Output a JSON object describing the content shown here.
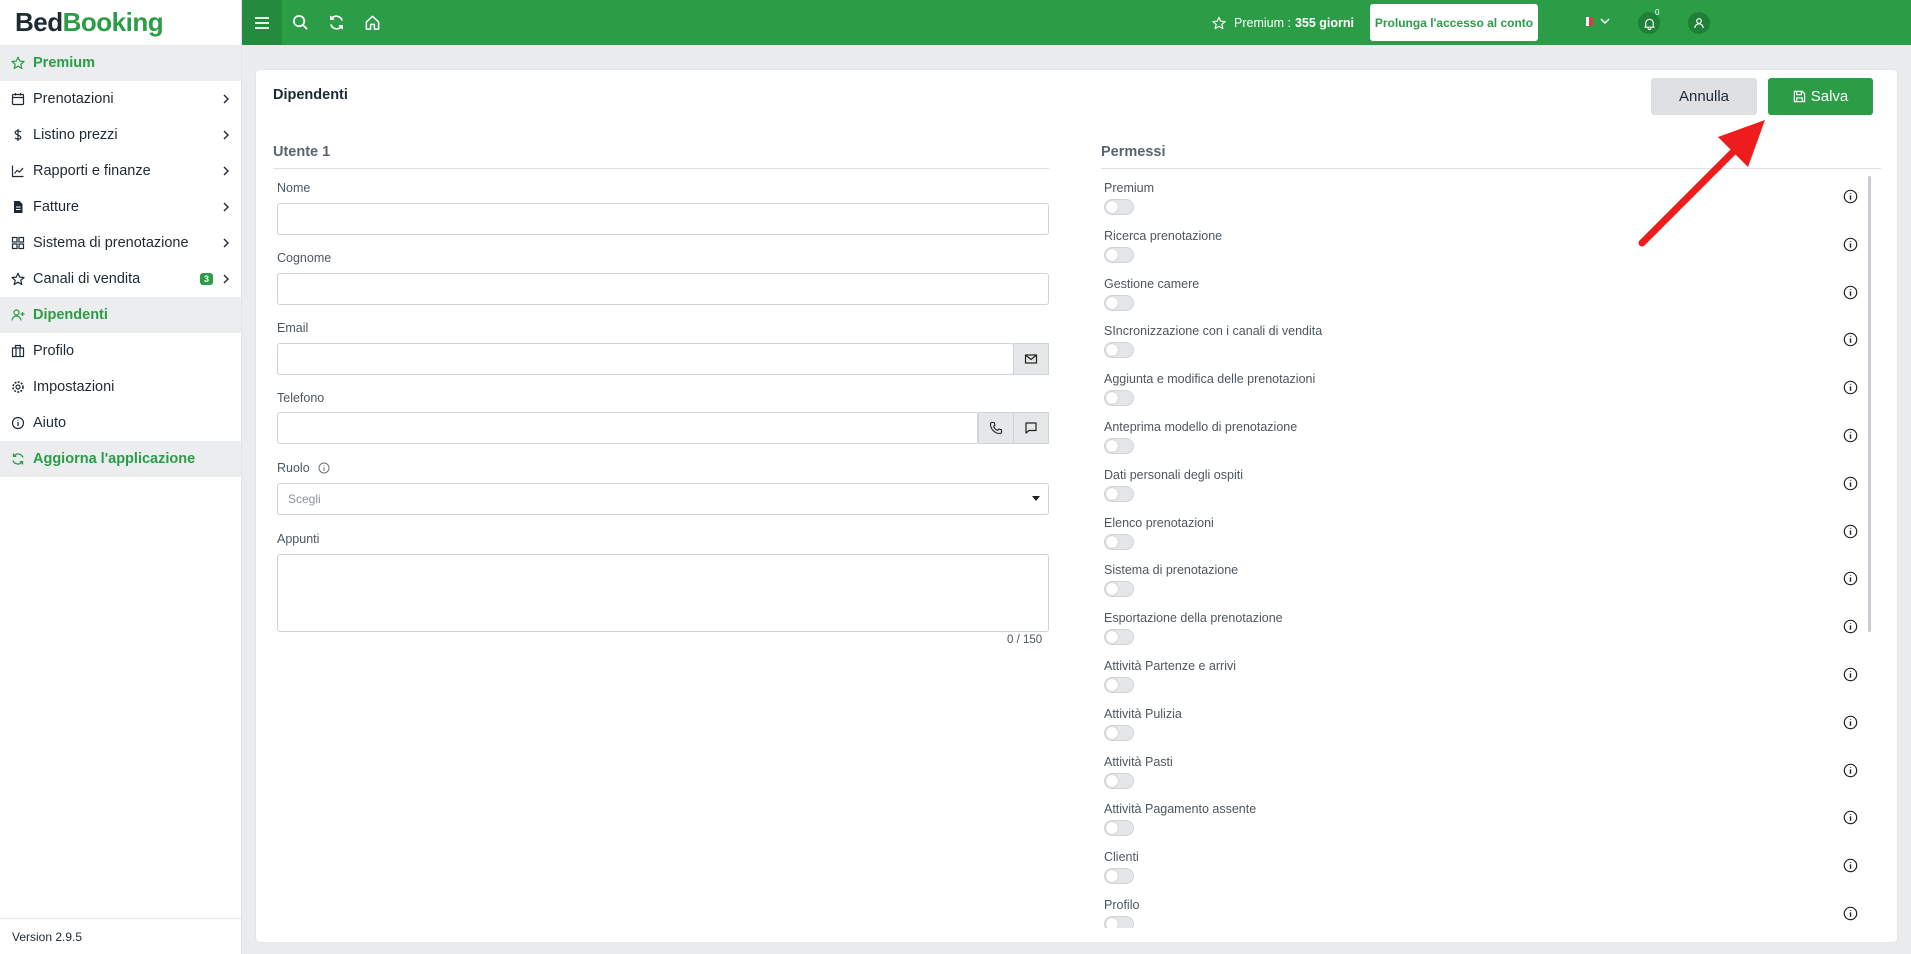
{
  "brand": {
    "part1": "Bed",
    "part2": "Booking"
  },
  "sidebar": {
    "items": [
      {
        "label": "Premium",
        "icon": "star-icon"
      },
      {
        "label": "Prenotazioni",
        "icon": "calendar-icon"
      },
      {
        "label": "Listino prezzi",
        "icon": "dollar-icon"
      },
      {
        "label": "Rapporti e finanze",
        "icon": "chart-icon"
      },
      {
        "label": "Fatture",
        "icon": "document-icon"
      },
      {
        "label": "Sistema di prenotazione",
        "icon": "grid-icon"
      },
      {
        "label": "Canali di vendita",
        "icon": "star-icon",
        "badge": "3"
      },
      {
        "label": "Dipendenti",
        "icon": "user-add-icon"
      },
      {
        "label": "Profilo",
        "icon": "building-icon"
      },
      {
        "label": "Impostazioni",
        "icon": "gear-icon"
      },
      {
        "label": "Aiuto",
        "icon": "info-icon"
      },
      {
        "label": "Aggiorna l'applicazione",
        "icon": "refresh-icon"
      }
    ],
    "version": "Version 2.9.5"
  },
  "topbar": {
    "premium_label": "Premium :",
    "premium_days": "355 giorni",
    "extend_label": "Prolunga l'accesso al conto",
    "notifications_count": "0"
  },
  "page": {
    "title": "Dipendenti",
    "cancel_label": "Annulla",
    "save_label": "Salva"
  },
  "user_form": {
    "section_title": "Utente 1",
    "name_label": "Nome",
    "surname_label": "Cognome",
    "email_label": "Email",
    "phone_label": "Telefono",
    "role_label": "Ruolo",
    "role_placeholder": "Scegli",
    "notes_label": "Appunti",
    "notes_counter": "0 / 150"
  },
  "permissions": {
    "section_title": "Permessi",
    "items": [
      "Premium",
      "Ricerca prenotazione",
      "Gestione camere",
      "SIncronizzazione con i canali di vendita",
      "Aggiunta e modifica delle prenotazioni",
      "Anteprima modello di prenotazione",
      "Dati personali degli ospiti",
      "Elenco prenotazioni",
      "Sistema di prenotazione",
      "Esportazione della prenotazione",
      "Attività Partenze e arrivi",
      "Attività Pulizia",
      "Attività Pasti",
      "Attività Pagamento assente",
      "Clienti",
      "Profilo"
    ]
  },
  "colors": {
    "brand_green": "#2a9d46",
    "arrow_red": "#ee1c1c"
  }
}
